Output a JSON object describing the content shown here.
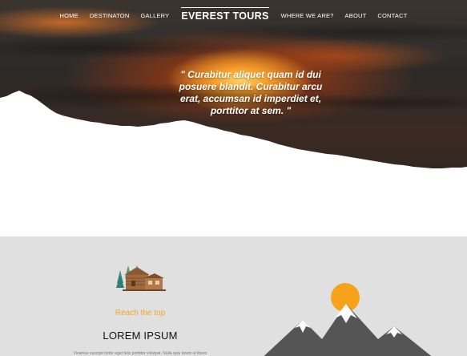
{
  "nav": {
    "left": [
      "HOME",
      "DESTINATON",
      "GALLERY"
    ],
    "brand": "EVEREST TOURS",
    "right": [
      "WHERE WE ARE?",
      "ABOUT",
      "CONTACT"
    ]
  },
  "hero": {
    "quote": "\" Curabitur aliquet quam id dui posuere blandit. Curabitur arcu erat, accumsan id imperdiet et, porttitor at sem. \""
  },
  "feature": {
    "icon": "cabin-icon",
    "subtitle": "Reach the top",
    "title": "LOREM IPSUM",
    "text": "Vivamus suscipit tortor eget felis porttitor volutpat. Nulla quis lorem ut libero",
    "logo": "mountain-sun-icon"
  },
  "colors": {
    "accent": "#f5a623",
    "section_bg": "#e0e0e0",
    "mountain": "#555555",
    "sun": "#f7a21b"
  }
}
